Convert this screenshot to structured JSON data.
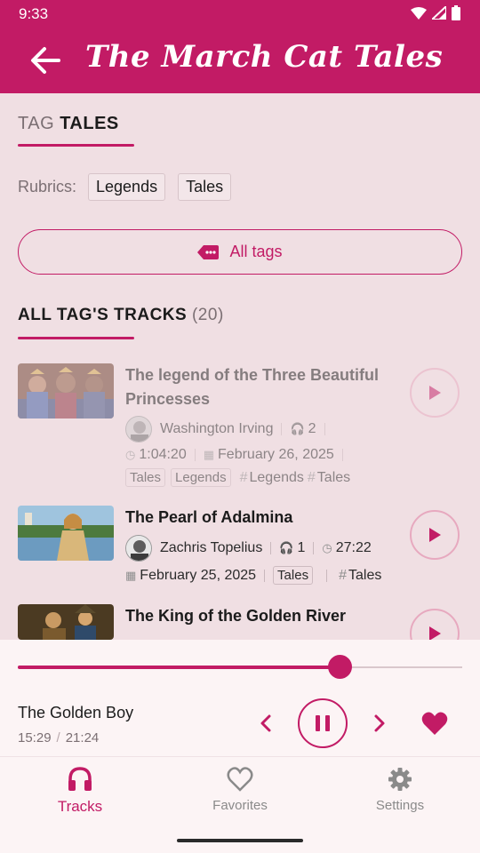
{
  "status_bar": {
    "time": "9:33"
  },
  "app_bar": {
    "title": "The March Cat Tales"
  },
  "tag_header": {
    "prefix": "TAG",
    "name": "TALES"
  },
  "rubrics": {
    "label": "Rubrics:",
    "items": [
      "Legends",
      "Tales"
    ]
  },
  "all_tags_button": {
    "label": "All tags"
  },
  "section": {
    "title": "ALL TAG'S TRACKS",
    "count": "(20)"
  },
  "tracks": [
    {
      "title": "The legend of the Three Beautiful Princesses",
      "author": "Washington Irving",
      "listens": "2",
      "duration": "1:04:20",
      "date": "February 26, 2025",
      "rubrics": [
        "Tales",
        "Legends"
      ],
      "tags": [
        "Legends",
        "Tales"
      ],
      "faded": true
    },
    {
      "title": "The Pearl of Adalmina",
      "author": "Zachris Topelius",
      "listens": "1",
      "duration": "27:22",
      "date": "February 25, 2025",
      "rubrics": [
        "Tales"
      ],
      "tags": [
        "Tales"
      ],
      "faded": false
    },
    {
      "title": "The King of the Golden River",
      "faded": false
    }
  ],
  "player": {
    "title": "The Golden Boy",
    "elapsed": "15:29",
    "total": "21:24",
    "progress": 0.724,
    "favorite": true
  },
  "bottom_nav": {
    "items": [
      {
        "label": "Tracks",
        "icon": "headphones-icon",
        "active": true
      },
      {
        "label": "Favorites",
        "icon": "heart-outline-icon",
        "active": false
      },
      {
        "label": "Settings",
        "icon": "gear-icon",
        "active": false
      }
    ]
  },
  "colors": {
    "primary": "#c21b65",
    "background": "#f0dfe3",
    "surface": "#fcf4f5",
    "muted": "#7b6f73"
  }
}
